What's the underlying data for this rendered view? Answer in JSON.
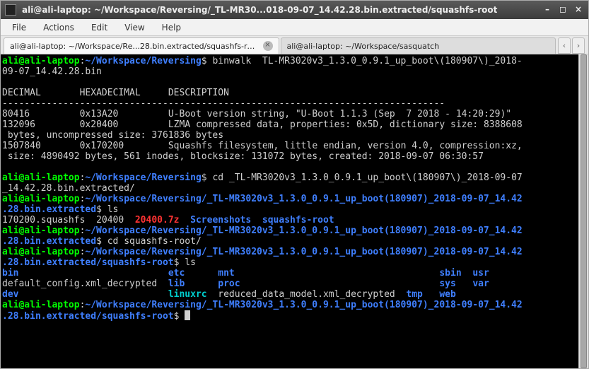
{
  "window": {
    "title": "ali@ali-laptop: ~/Workspace/Reversing/_TL-MR30...018-09-07_14.42.28.bin.extracted/squashfs-root"
  },
  "menu": {
    "file": "File",
    "actions": "Actions",
    "edit": "Edit",
    "view": "View",
    "help": "Help"
  },
  "tabs": {
    "t0": "ali@ali-laptop: ~/Workspace/Re...28.bin.extracted/squashfs-root",
    "t1": "ali@ali-laptop: ~/Workspace/sasquatch"
  },
  "prompt_user": "ali@ali-laptop",
  "paths": {
    "reversing": "~/Workspace/Reversing",
    "extracted_short": "~/Workspace/Reversing/_TL-MR3020v3_1.3.0_0.9.1_up_boot(180907)_2018-09-07_14.42",
    "extracted_line2": ".28.bin.extracted",
    "sqfs_line2": ".28.bin.extracted/squashfs-root"
  },
  "cmds": {
    "binwalk": "binwalk  TL-MR3020v3_1.3.0_0.9.1_up_boot\\(180907\\)_2018-",
    "binwalk2": "09-07_14.42.28.bin",
    "cd_ext": "cd _TL-MR3020v3_1.3.0_0.9.1_up_boot\\(180907\\)_2018-09-07",
    "cd_ext2": "_14.42.28.bin.extracted/",
    "ls": "ls",
    "cd_sq": "cd squashfs-root/"
  },
  "binwalk": {
    "headers": {
      "dec": "DECIMAL",
      "hex": "HEXADECIMAL",
      "desc": "DESCRIPTION"
    },
    "sep": "--------------------------------------------------------------------------------",
    "row1": {
      "dec": "80416",
      "hex": "0x13A20",
      "desc": "U-Boot version string, \"U-Boot 1.1.3 (Sep  7 2018 - 14:20:29)\""
    },
    "row2": {
      "dec": "132096",
      "hex": "0x20400",
      "desc1": "LZMA compressed data, properties: 0x5D, dictionary size: 8388608",
      "desc2": " bytes, uncompressed size: 3761836 bytes"
    },
    "row3": {
      "dec": "1507840",
      "hex": "0x170200",
      "desc1": "Squashfs filesystem, little endian, version 4.0, compression:xz,",
      "desc2": " size: 4890492 bytes, 561 inodes, blocksize: 131072 bytes, created: 2018-09-07 06:30:57"
    }
  },
  "ls_extracted": {
    "f1": "170200.squashfs",
    "f2": "20400",
    "f3": "20400.7z",
    "d1": "Screenshots",
    "d2": "squashfs-root"
  },
  "ls_sqfs": {
    "c1r1": "bin",
    "c2r1": "etc",
    "c3r1": "mnt",
    "c4r1": "",
    "c5r1": "sbin",
    "c6r1": "usr",
    "c1r2": "default_config.xml_decrypted",
    "c2r2": "lib",
    "c3r2": "proc",
    "c4r2": "",
    "c5r2": "sys",
    "c6r2": "var",
    "c1r3": "dev",
    "c2r3": "linuxrc",
    "c3r3": "",
    "c4r3": "reduced_data_model.xml_decrypted",
    "c5r3": "tmp",
    "c6r3": "web"
  },
  "dollar": "$"
}
